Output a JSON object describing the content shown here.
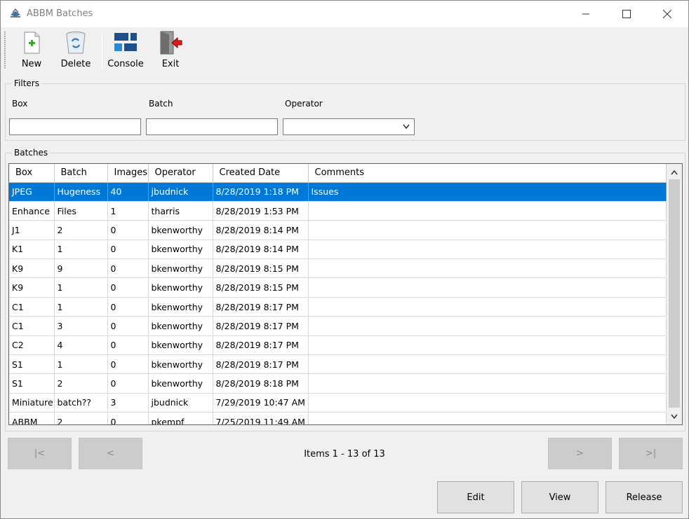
{
  "window": {
    "title": "ABBM Batches"
  },
  "toolbar": {
    "new_label": "New",
    "delete_label": "Delete",
    "console_label": "Console",
    "exit_label": "Exit"
  },
  "filters": {
    "legend": "Filters",
    "box_label": "Box",
    "box_value": "",
    "batch_label": "Batch",
    "batch_value": "",
    "operator_label": "Operator",
    "operator_value": ""
  },
  "batches": {
    "legend": "Batches",
    "columns": [
      "Box",
      "Batch",
      "Images",
      "Operator",
      "Created Date",
      "Comments"
    ],
    "rows": [
      [
        "JPEG",
        "Hugeness",
        "40",
        "jbudnick",
        "8/28/2019 1:18 PM",
        "Issues"
      ],
      [
        "Enhance",
        "Files",
        "1",
        "tharris",
        "8/28/2019 1:53 PM",
        ""
      ],
      [
        "J1",
        "2",
        "0",
        "bkenworthy",
        "8/28/2019 8:14 PM",
        ""
      ],
      [
        "K1",
        "1",
        "0",
        "bkenworthy",
        "8/28/2019 8:14 PM",
        ""
      ],
      [
        "K9",
        "9",
        "0",
        "bkenworthy",
        "8/28/2019 8:15 PM",
        ""
      ],
      [
        "K9",
        "1",
        "0",
        "bkenworthy",
        "8/28/2019 8:15 PM",
        ""
      ],
      [
        "C1",
        "1",
        "0",
        "bkenworthy",
        "8/28/2019 8:17 PM",
        ""
      ],
      [
        "C1",
        "3",
        "0",
        "bkenworthy",
        "8/28/2019 8:17 PM",
        ""
      ],
      [
        "C2",
        "4",
        "0",
        "bkenworthy",
        "8/28/2019 8:17 PM",
        ""
      ],
      [
        "S1",
        "1",
        "0",
        "bkenworthy",
        "8/28/2019 8:17 PM",
        ""
      ],
      [
        "S1",
        "2",
        "0",
        "bkenworthy",
        "8/28/2019 8:18 PM",
        ""
      ],
      [
        "Miniature",
        "batch??",
        "3",
        "jbudnick",
        "7/29/2019 10:47 AM",
        ""
      ],
      [
        "ABBM",
        "2",
        "0",
        "pkempf",
        "7/25/2019 11:49 AM",
        ""
      ]
    ],
    "selected_row": 0
  },
  "pager": {
    "first_label": "|<",
    "prev_label": "<",
    "next_label": ">",
    "last_label": ">|",
    "count_text": "Items 1 - 13 of 13"
  },
  "actions": {
    "edit_label": "Edit",
    "view_label": "View",
    "release_label": "Release"
  },
  "colors": {
    "selection": "#0078d7"
  }
}
